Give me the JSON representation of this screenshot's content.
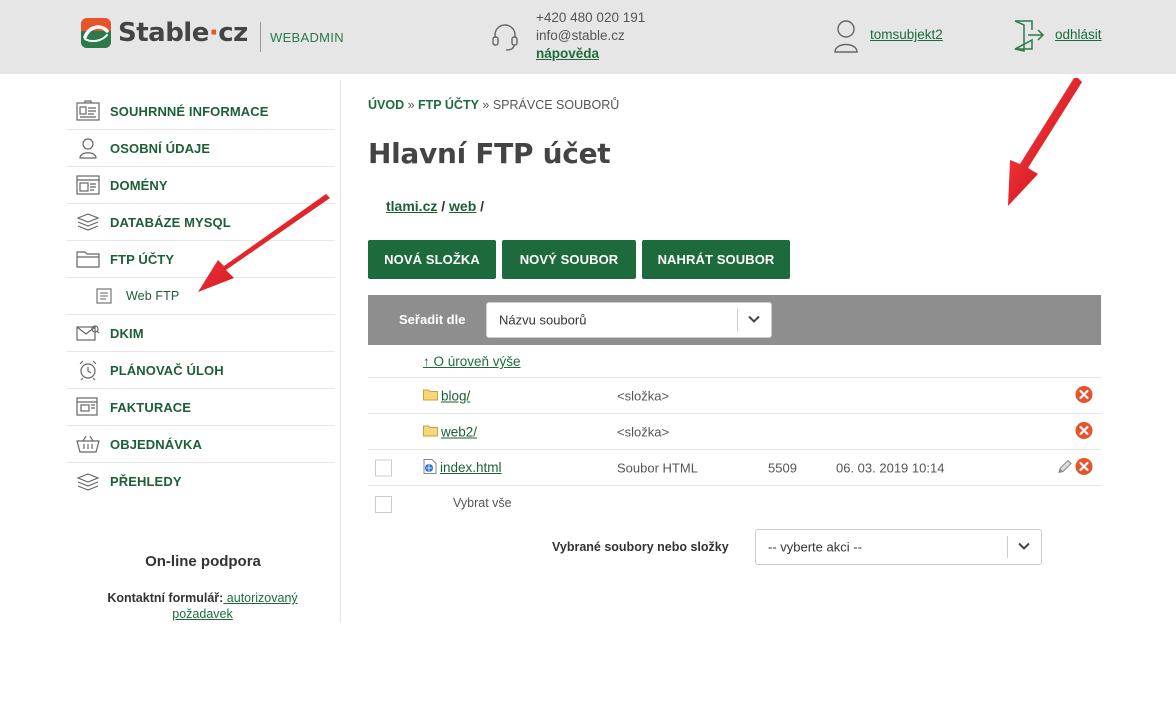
{
  "header": {
    "logo_text_a": "Stable",
    "logo_text_dot": "·",
    "logo_text_b": "cz",
    "subtitle": "WEBADMIN",
    "phone": "+420 480 020 191",
    "email": "info@stable.cz",
    "help": "nápověda",
    "username": "tomsubjekt2",
    "logout": "odhlásit"
  },
  "sidebar": {
    "items": [
      {
        "label": "SOUHRNNÉ INFORMACE",
        "icon": "id-card-icon"
      },
      {
        "label": "OSOBNÍ ÚDAJE",
        "icon": "person-icon"
      },
      {
        "label": "DOMÉNY",
        "icon": "browser-window-icon"
      },
      {
        "label": "DATABÁZE MYSQL",
        "icon": "database-icon"
      },
      {
        "label": "FTP ÚČTY",
        "icon": "folder-icon"
      },
      {
        "label": "Web FTP",
        "icon": "document-icon"
      },
      {
        "label": "DKIM",
        "icon": "envelope-key-icon"
      },
      {
        "label": "PLÁNOVAČ ÚLOH",
        "icon": "alarm-clock-icon"
      },
      {
        "label": "FAKTURACE",
        "icon": "invoice-icon"
      },
      {
        "label": "OBJEDNÁVKA",
        "icon": "basket-icon"
      },
      {
        "label": "PŘEHLEDY",
        "icon": "stack-icon"
      }
    ],
    "support_title": "On-line podpora",
    "support_label": "Kontaktní formulář:",
    "support_link": " autorizovaný požadavek"
  },
  "breadcrumb": {
    "home": "ÚVOD",
    "sep1": " » ",
    "ftp": "FTP ÚČTY",
    "sep2": " » ",
    "current": "SPRÁVCE SOUBORŮ"
  },
  "page_title": "Hlavní FTP účet",
  "path": {
    "root": "tlami.cz",
    "sep1": " / ",
    "folder": "web",
    "sep2": " /"
  },
  "buttons": {
    "new_folder": "NOVÁ SLOŽKA",
    "new_file": "NOVÝ SOUBOR",
    "upload": "NAHRÁT SOUBOR"
  },
  "sort": {
    "label": "Seřadit dle",
    "selected": "Názvu souborů"
  },
  "files": {
    "up_link": "↑ O úroveň výše",
    "rows": [
      {
        "name": "blog/",
        "type": "<složka>",
        "size": "",
        "date": ""
      },
      {
        "name": "web2/",
        "type": "<složka>",
        "size": "",
        "date": ""
      },
      {
        "name": "index.html",
        "type": "Soubor HTML",
        "size": "5509",
        "date": "06. 03. 2019 10:14"
      }
    ],
    "select_all": "Vybrat vše"
  },
  "bulk": {
    "label": "Vybrané soubory nebo složky",
    "selected": "-- vyberte akci --"
  },
  "colors": {
    "brand_green": "#1d6b3c",
    "header_bg": "#e6e6e6",
    "delete_red": "#e5542c",
    "annotation_red": "#e8141b"
  }
}
